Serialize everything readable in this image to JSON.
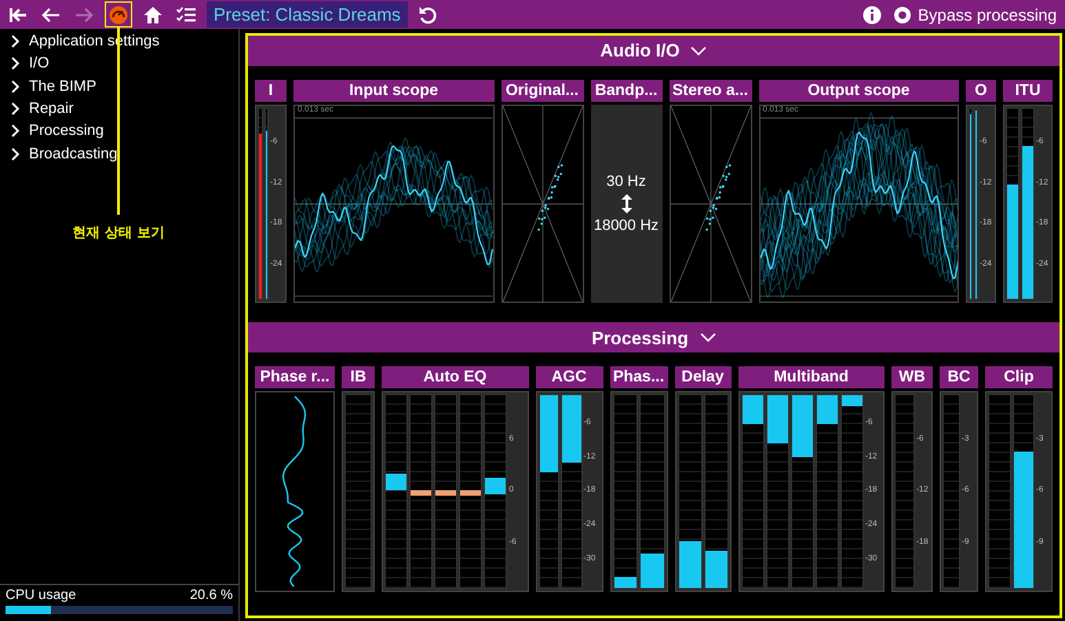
{
  "toolbar": {
    "left": [
      {
        "kind": "first",
        "disabled": false
      },
      {
        "kind": "back",
        "disabled": false
      },
      {
        "kind": "forward",
        "disabled": true
      },
      {
        "kind": "status",
        "disabled": false,
        "callout": "현재 상태 보기"
      },
      {
        "kind": "home",
        "disabled": false
      },
      {
        "kind": "presets",
        "disabled": false
      },
      {
        "kind": "preset",
        "label": "Preset: Classic Dreams"
      },
      {
        "kind": "undo",
        "disabled": false
      }
    ],
    "right": [
      {
        "kind": "info"
      },
      {
        "kind": "bypass",
        "label": "Bypass processing",
        "checked": false
      }
    ]
  },
  "sidebar": {
    "items": [
      {
        "label": "Application settings",
        "expanded": false
      },
      {
        "label": "I/O",
        "expanded": false
      },
      {
        "label": "The BIMP",
        "expanded": false
      },
      {
        "label": "Repair",
        "expanded": false
      },
      {
        "label": "Processing",
        "expanded": false
      },
      {
        "label": "Broadcasting",
        "expanded": false
      }
    ],
    "cpu": {
      "label": "CPU usage",
      "value": "20.6 %",
      "level": 0.2
    }
  },
  "sections": [
    {
      "title": "Audio I/O",
      "expanded": true,
      "panels": [
        {
          "title": "I",
          "kind": "meter",
          "scale": [
            "-6",
            "-12",
            "-18",
            "-24"
          ],
          "bars": [
            {
              "level": 0.87,
              "color": "#ff1a1a"
            },
            {
              "level": 0.88,
              "color": "#19c8f0"
            }
          ]
        },
        {
          "title": "Input scope",
          "kind": "scope",
          "caption": "0.013 sec"
        },
        {
          "title": "Original...",
          "kind": "vectorscope"
        },
        {
          "title": "Bandp...",
          "kind": "bandpass",
          "low": "30 Hz",
          "high": "18000 Hz"
        },
        {
          "title": "Stereo a...",
          "kind": "vectorscope"
        },
        {
          "title": "Output scope",
          "kind": "scope",
          "caption": "0.013 sec"
        },
        {
          "title": "O",
          "kind": "meter",
          "scale": [
            "-6",
            "-12",
            "-18",
            "-24"
          ],
          "bars": [
            {
              "level": 0.97,
              "color": "#19c8f0"
            },
            {
              "level": 0.99,
              "color": "#19c8f0"
            }
          ]
        },
        {
          "title": "ITU",
          "kind": "meter",
          "scale": [
            "-6",
            "-12",
            "-18",
            "-24"
          ],
          "bars": [
            {
              "level": 0.6,
              "color": "#19c8f0"
            },
            {
              "level": 0.8,
              "color": "#19c8f0"
            }
          ]
        }
      ]
    },
    {
      "title": "Processing",
      "expanded": true,
      "panels": [
        {
          "title": "Phase r...",
          "kind": "phase"
        },
        {
          "title": "IB",
          "kind": "meter",
          "bars": [
            {
              "kind": "empty"
            }
          ]
        },
        {
          "title": "Auto EQ",
          "kind": "eq",
          "scale": [
            "6",
            "0",
            "-6"
          ],
          "bars": [
            {
              "level": 0.55,
              "kind": "boost",
              "color": "#19c8f0"
            },
            {
              "level": 0.49,
              "kind": "flat",
              "color": "#f0a070"
            },
            {
              "level": 0.49,
              "kind": "flat",
              "color": "#f0a070"
            },
            {
              "level": 0.49,
              "kind": "flat",
              "color": "#f0a070"
            },
            {
              "level": 0.53,
              "kind": "boost",
              "color": "#19c8f0"
            }
          ]
        },
        {
          "title": "AGC",
          "kind": "reduction",
          "scale": [
            "-6",
            "-12",
            "-18",
            "-24",
            "-30"
          ],
          "bars": [
            {
              "level": 0.4,
              "color": "#19c8f0"
            },
            {
              "level": 0.35,
              "color": "#19c8f0"
            }
          ]
        },
        {
          "title": "Phas...",
          "kind": "meter",
          "bars": [
            {
              "level": 0.06,
              "color": "#19c8f0"
            },
            {
              "level": 0.18,
              "color": "#19c8f0"
            }
          ]
        },
        {
          "title": "Delay",
          "kind": "meter",
          "bars": [
            {
              "level": 0.24,
              "color": "#19c8f0"
            },
            {
              "level": 0.19,
              "color": "#19c8f0"
            }
          ]
        },
        {
          "title": "Multiband",
          "kind": "reduction",
          "scale": [
            "-6",
            "-12",
            "-18",
            "-24",
            "-30"
          ],
          "bars": [
            {
              "level": 0.15,
              "color": "#19c8f0"
            },
            {
              "level": 0.25,
              "color": "#19c8f0"
            },
            {
              "level": 0.32,
              "color": "#19c8f0"
            },
            {
              "level": 0.15,
              "color": "#19c8f0"
            },
            {
              "level": 0.06,
              "color": "#19c8f0"
            }
          ]
        },
        {
          "title": "WB",
          "kind": "meter",
          "scale": [
            "-6",
            "-12",
            "-18"
          ],
          "bars": [
            {
              "kind": "empty"
            }
          ]
        },
        {
          "title": "BC",
          "kind": "meter",
          "scale": [
            "-3",
            "-6",
            "-9"
          ],
          "bars": [
            {
              "kind": "empty"
            }
          ]
        },
        {
          "title": "Clip",
          "kind": "meter",
          "scale": [
            "-3",
            "-6",
            "-9"
          ],
          "bars": [
            {
              "kind": "empty"
            },
            {
              "kind": "level",
              "level": 0.71,
              "color": "#19c8f0"
            }
          ]
        }
      ]
    }
  ]
}
